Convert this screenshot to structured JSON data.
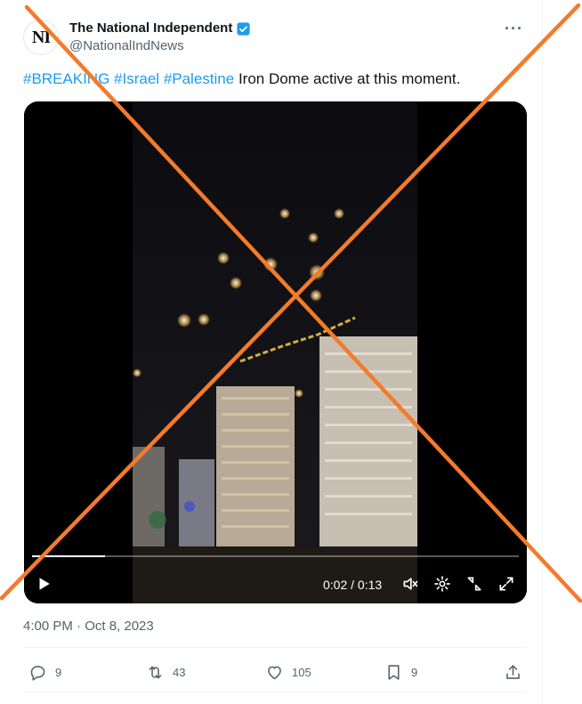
{
  "author": {
    "avatar_text": "NI",
    "display_name": "The National Independent",
    "handle": "@NationalIndNews",
    "more_icon": "more-horizontal-icon",
    "verified_icon": "verified-badge-icon"
  },
  "tweet": {
    "tags": [
      "#BREAKING",
      "#Israel",
      "#Palestine"
    ],
    "text": "Iron Dome active at this moment.",
    "timestamp": "4:00 PM · Oct 8, 2023"
  },
  "video": {
    "time_display": "0:02 / 0:13",
    "progress": 0.15,
    "controls": [
      "play-icon",
      "volume-icon",
      "settings-icon",
      "exit-fullscreen-corner-icon",
      "expand-icon"
    ]
  },
  "actions": {
    "replies": "9",
    "retweets": "43",
    "likes": "105",
    "bookmarks": "9"
  },
  "colors": {
    "accent": "#1d9bf0",
    "overlay_x": "#f47b2a",
    "muted": "#536471"
  }
}
